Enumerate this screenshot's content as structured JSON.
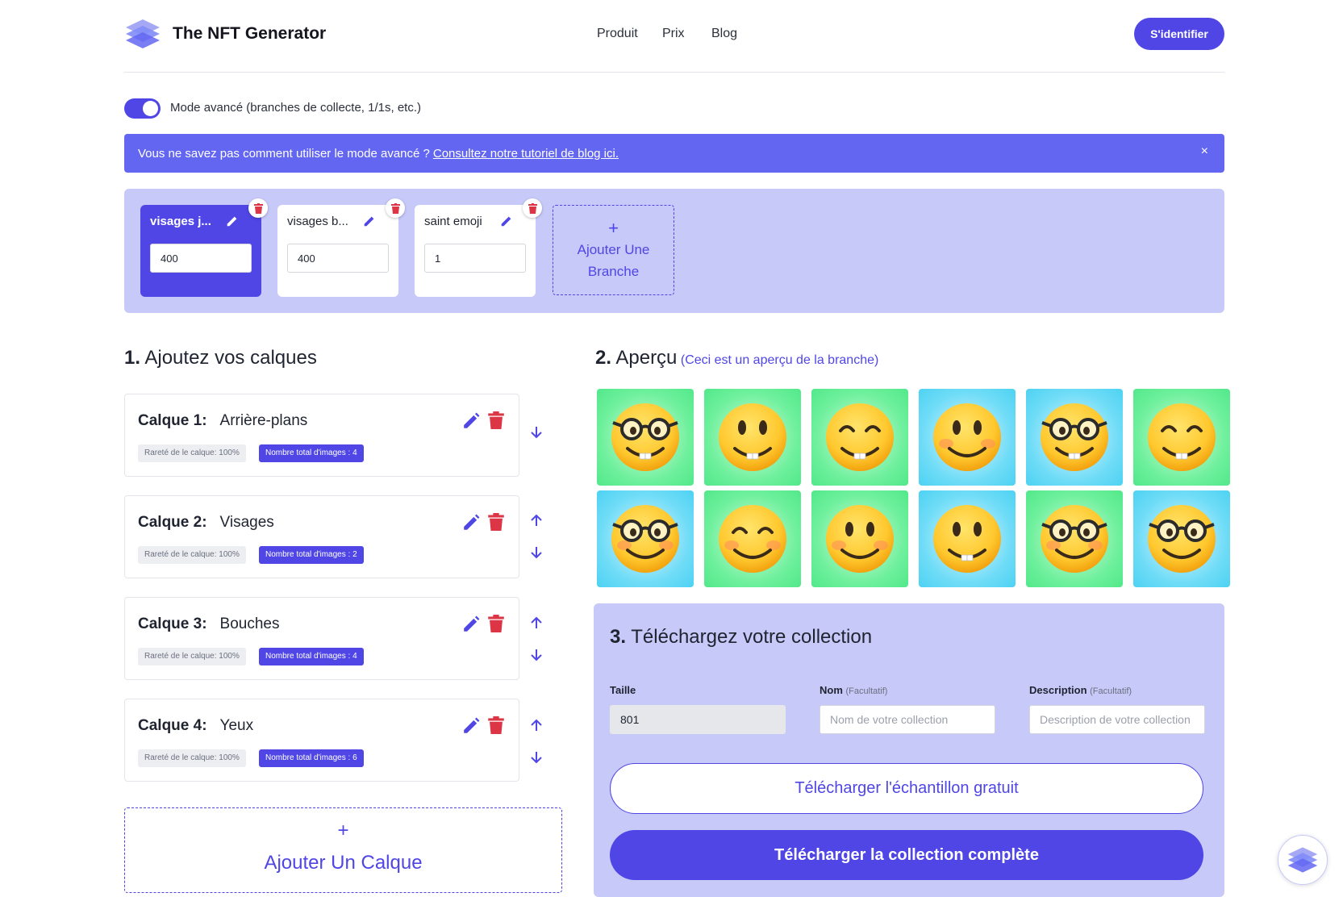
{
  "header": {
    "brand": "The NFT Generator",
    "nav": [
      "Produit",
      "Prix",
      "Blog"
    ],
    "signin_label": "S'identifier"
  },
  "mode": {
    "toggle_on": true,
    "label": "Mode avancé (branches de collecte, 1/1s, etc.)"
  },
  "banner": {
    "text": "Vous ne savez pas comment utiliser le mode avancé ?",
    "link": "Consultez notre tutoriel de blog ici.",
    "close": "×"
  },
  "branches": {
    "items": [
      {
        "name": "visages j...",
        "value": "400",
        "active": true
      },
      {
        "name": "visages b...",
        "value": "400",
        "active": false
      },
      {
        "name": "saint emoji",
        "value": "1",
        "active": false
      }
    ],
    "add_plus": "+",
    "add_label_1": "Ajouter Une",
    "add_label_2": "Branche"
  },
  "layers_section": {
    "number": "1.",
    "title": "Ajoutez vos calques",
    "items": [
      {
        "label": "Calque 1:",
        "name": "Arrière-plans",
        "rarity": "Rareté de le calque: 100%",
        "count": "Nombre total d'images : 4"
      },
      {
        "label": "Calque 2:",
        "name": "Visages",
        "rarity": "Rareté de le calque: 100%",
        "count": "Nombre total d'images : 2"
      },
      {
        "label": "Calque 3:",
        "name": "Bouches",
        "rarity": "Rareté de le calque: 100%",
        "count": "Nombre total d'images : 4"
      },
      {
        "label": "Calque 4:",
        "name": "Yeux",
        "rarity": "Rareté de le calque: 100%",
        "count": "Nombre total d'images : 6"
      }
    ],
    "add_plus": "+",
    "add_label": "Ajouter Un Calque"
  },
  "preview_section": {
    "number": "2.",
    "title": "Aperçu",
    "subtitle": "(Ceci est un aperçu de la branche)",
    "tiles": [
      {
        "bg": "green",
        "face": "glasses-teeth"
      },
      {
        "bg": "green",
        "face": "smile-teeth"
      },
      {
        "bg": "green",
        "face": "happy-teeth"
      },
      {
        "bg": "blue",
        "face": "smile-blush"
      },
      {
        "bg": "blue",
        "face": "glasses-teeth"
      },
      {
        "bg": "green",
        "face": "happy-teeth"
      },
      {
        "bg": "blue",
        "face": "glasses-blush"
      },
      {
        "bg": "green",
        "face": "happy-blush"
      },
      {
        "bg": "green",
        "face": "smile-blush"
      },
      {
        "bg": "blue",
        "face": "smile-teeth"
      },
      {
        "bg": "green",
        "face": "glasses-blush"
      },
      {
        "bg": "blue",
        "face": "glasses-smile"
      }
    ]
  },
  "download_section": {
    "number": "3.",
    "title": "Téléchargez votre collection",
    "size_label": "Taille",
    "size_value": "801",
    "name_label": "Nom",
    "name_optional": "(Facultatif)",
    "name_placeholder": "Nom de votre collection",
    "desc_label": "Description",
    "desc_optional": "(Facultatif)",
    "desc_placeholder": "Description de votre collection",
    "sample_button": "Télécharger l'échantillon gratuit",
    "full_button": "Télécharger la collection complète"
  },
  "colors": {
    "accent": "#4f46e5",
    "banner": "#6366f1",
    "panel": "#c7c9f9",
    "delete": "#dc3545"
  }
}
